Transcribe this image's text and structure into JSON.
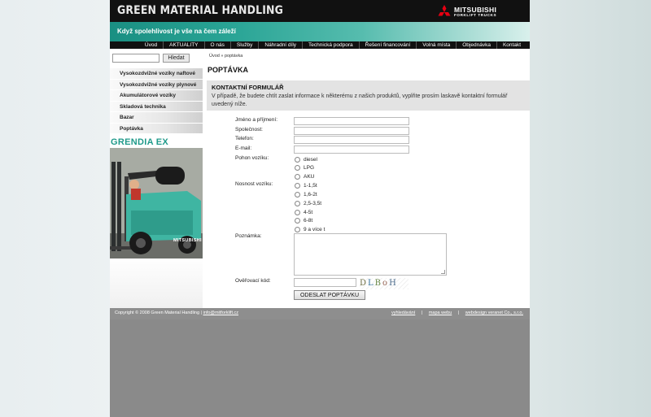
{
  "header": {
    "brand": "GREEN MATERIAL HANDLING",
    "logo_text": "MITSUBISHI",
    "logo_sub": "FORKLIFT TRUCKS",
    "slogan": "Když spolehlivost je vše na čem záleží"
  },
  "nav": [
    "Úvod",
    "AKTUALITY",
    "O nás",
    "Služby",
    "Náhradní díly",
    "Technická podpora",
    "Řešení financování",
    "Volná místa",
    "Objednávka",
    "Kontakt"
  ],
  "sidebar": {
    "search_value": "",
    "search_button": "Hledat",
    "items": [
      "Vysokozdvižné vozíky naftové",
      "Vysokozdvižné vozíky plynové",
      "Akumulátorové vozíky",
      "Skladová technika",
      "Bazar",
      "Poptávka"
    ],
    "promo_title": "GRENDIA EX",
    "promo_brand": "MITSUBISHI"
  },
  "content": {
    "breadcrumb_home": "Úvod",
    "breadcrumb_sep": "»",
    "breadcrumb_current": "poptávka",
    "page_title": "POPTÁVKA",
    "form_title": "KONTAKTNÍ FORMULÁŘ",
    "form_desc": "V případě, že budete chtít zaslat informace k některému z našich produktů, vyplňte prosím laskavě kontaktní formulář uvedený níže.",
    "labels": {
      "name": "Jméno a příjmení:",
      "company": "Společnost:",
      "phone": "Telefon:",
      "email": "E-mail:",
      "drive": "Pohon vozíku:",
      "capacity": "Nosnost vozíku:",
      "note": "Poznámka:",
      "captcha": "Ověřovací kód:"
    },
    "drive_options": [
      "diesel",
      "LPG",
      "AKU"
    ],
    "capacity_options": [
      "1-1,5t",
      "1,6-2t",
      "2,5-3,5t",
      "4-5t",
      "6-8t",
      "9 a více t"
    ],
    "captcha_chars": [
      "D",
      "L",
      "B",
      "o",
      "H"
    ],
    "submit": "ODESLAT POPTÁVKU"
  },
  "footer": {
    "copyright": "Copyright © 2008 Green Material Handling |",
    "email": "info@mitforklift.cz",
    "links": [
      "vyhledávání",
      "mapa webu",
      "webdesign veranet Co., s.r.o."
    ],
    "sep": "|"
  }
}
